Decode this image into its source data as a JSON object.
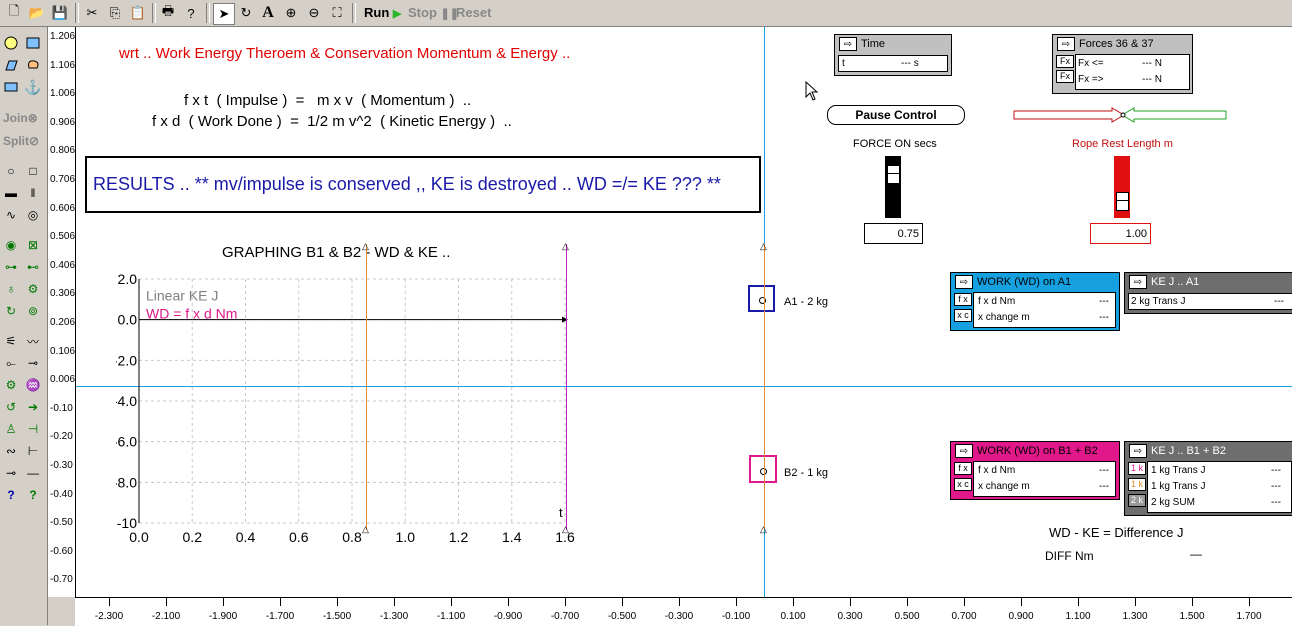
{
  "toolbar": {
    "run_label": "Run",
    "stop_label": "Stop",
    "reset_label": "Reset"
  },
  "palette": {
    "join_label": "Join",
    "split_label": "Split"
  },
  "vertical_ruler": [
    "1.206",
    "1.106",
    "1.006",
    "0.906",
    "0.806",
    "0.706",
    "0.606",
    "0.506",
    "0.406",
    "0.306",
    "0.206",
    "0.106",
    "0.006",
    "-0.10",
    "-0.20",
    "-0.30",
    "-0.40",
    "-0.50",
    "-0.60",
    "-0.70"
  ],
  "horizontal_ruler": [
    "-2.300",
    "-2.100",
    "-1.900",
    "-1.700",
    "-1.500",
    "-1.300",
    "-1.100",
    "-0.900",
    "-0.700",
    "-0.500",
    "-0.300",
    "-0.100",
    "0.100",
    "0.300",
    "0.500",
    "0.700",
    "0.900",
    "1.100",
    "1.300",
    "1.500",
    "1.700"
  ],
  "workspace": {
    "title": "wrt .. Work Energy Theroem & Conservation Momentum & Energy ..",
    "eq1": "f x t  ( Impulse )  =   m x v  ( Momentum )  ..",
    "eq2": "f x d  ( Work Done )  =  1/2 m v^2  ( Kinetic Energy )  ..",
    "results": "RESULTS .. ** mv/impulse is conserved ,, KE is destroyed .. WD =/= KE ??? **",
    "graph_title": "GRAPHING B1 & B2 - WD & KE ..",
    "diff_text": "WD - KE = Difference J",
    "diff_nm_label": "DIFF Nm",
    "diff_nm_value": "—",
    "a1_label": "A1 - 2 kg",
    "b2_label": "B2 - 1 kg",
    "b1_label": "B1"
  },
  "chart_data": {
    "type": "line",
    "xlim": [
      0.0,
      1.6
    ],
    "ylim": [
      -10,
      2
    ],
    "y_ticks": [
      "2.0",
      "0.0",
      "-2.0",
      "-4.0",
      "-6.0",
      "-8.0",
      "-10"
    ],
    "x_ticks": [
      "0.0",
      "0.2",
      "0.4",
      "0.6",
      "0.8",
      "1.0",
      "1.2",
      "1.4",
      "1.6"
    ],
    "x_axis_label": "t",
    "series": [
      {
        "name": "Linear KE J",
        "color": "#808080"
      },
      {
        "name": "WD = f x d Nm",
        "color": "#e0188a"
      }
    ],
    "grid": true
  },
  "time_meter": {
    "title": "Time",
    "label": "t",
    "value": "--- s"
  },
  "forces_meter": {
    "title": "Forces 36 & 37",
    "rows": [
      {
        "tag": "Fx",
        "label": "Fx <=",
        "value": "--- N"
      },
      {
        "tag": "Fx",
        "label": "Fx =>",
        "value": "--- N"
      }
    ]
  },
  "pause_button": "Pause Control",
  "force_on": {
    "label": "FORCE ON secs",
    "value": "0.75"
  },
  "rope": {
    "label": "Rope Rest Length m",
    "value": "1.00"
  },
  "work_a1": {
    "title": "WORK (WD) on A1",
    "rows": [
      {
        "tag": "f x",
        "label": "f x d Nm",
        "value": "---"
      },
      {
        "tag": "x c",
        "label": "x change m",
        "value": "---"
      }
    ]
  },
  "ke_a1": {
    "title": "KE J .. A1",
    "rows": [
      {
        "label": "2 kg Trans J",
        "value": "---"
      }
    ]
  },
  "work_b": {
    "title": "WORK (WD) on B1 + B2",
    "rows": [
      {
        "tag": "f x",
        "label": "f x d Nm",
        "value": "---"
      },
      {
        "tag": "x c",
        "label": "x change m",
        "value": "---"
      }
    ]
  },
  "ke_b": {
    "title": "KE J .. B1 + B2",
    "rows": [
      {
        "tag": "1 k",
        "label": "1 kg Trans J",
        "value": "---"
      },
      {
        "tag": "1 k",
        "label": "1 kg Trans J",
        "value": "---"
      },
      {
        "tag": "2 k",
        "label": "2 kg SUM",
        "value": "---"
      }
    ]
  },
  "colors": {
    "title_red": "#e00000",
    "results_blue": "#1a1aa8",
    "cyan": "#16a0e0",
    "magenta": "#e0188a",
    "dark_gray": "#6e6e6e",
    "orange_line": "#e09030",
    "purple_line": "#c020c0"
  }
}
